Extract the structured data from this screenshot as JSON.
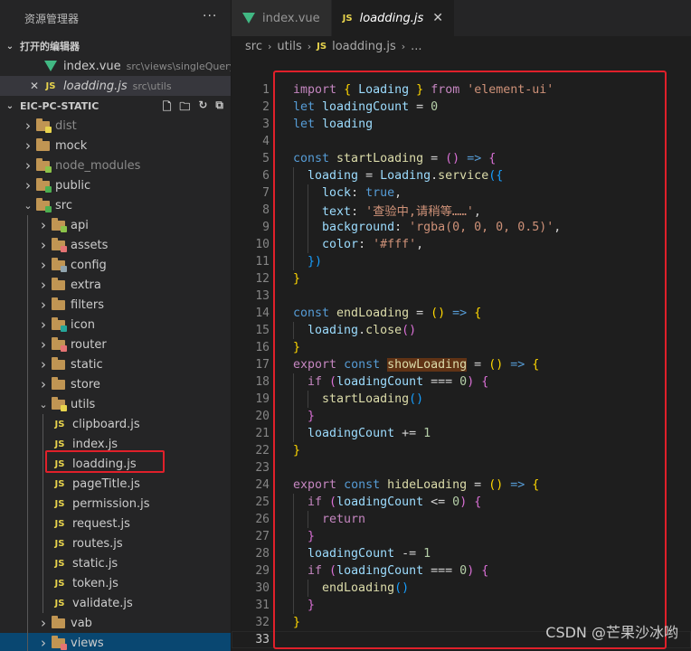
{
  "sidebar": {
    "title": "资源管理器",
    "more": "···",
    "open_editors": {
      "label": "打开的编辑器",
      "items": [
        {
          "name": "index.vue",
          "path": "src\\views\\singleQuery",
          "type": "vue"
        },
        {
          "name": "loadding.js",
          "path": "src\\utils",
          "type": "js"
        }
      ]
    },
    "project": {
      "label": "EIC-PC-STATIC",
      "tree": [
        {
          "label": "dist",
          "depth": 1,
          "folder": true,
          "open": false,
          "dim": true,
          "badge": "#e8d44d"
        },
        {
          "label": "mock",
          "depth": 1,
          "folder": true,
          "open": false
        },
        {
          "label": "node_modules",
          "depth": 1,
          "folder": true,
          "open": false,
          "dim": true,
          "badge": "#8bc34a"
        },
        {
          "label": "public",
          "depth": 1,
          "folder": true,
          "open": false,
          "badge": "#4caf50"
        },
        {
          "label": "src",
          "depth": 1,
          "folder": true,
          "open": true,
          "badge": "#4caf50"
        },
        {
          "label": "api",
          "depth": 2,
          "folder": true,
          "open": false,
          "badge": "#8bc34a"
        },
        {
          "label": "assets",
          "depth": 2,
          "folder": true,
          "open": false,
          "badge": "#e57373"
        },
        {
          "label": "config",
          "depth": 2,
          "folder": true,
          "open": false,
          "badge": "#90a4ae"
        },
        {
          "label": "extra",
          "depth": 2,
          "folder": true,
          "open": false
        },
        {
          "label": "filters",
          "depth": 2,
          "folder": true,
          "open": false
        },
        {
          "label": "icon",
          "depth": 2,
          "folder": true,
          "open": false,
          "badge": "#26a69a"
        },
        {
          "label": "router",
          "depth": 2,
          "folder": true,
          "open": false,
          "badge": "#e57373"
        },
        {
          "label": "static",
          "depth": 2,
          "folder": true,
          "open": false
        },
        {
          "label": "store",
          "depth": 2,
          "folder": true,
          "open": false
        },
        {
          "label": "utils",
          "depth": 2,
          "folder": true,
          "open": true,
          "badge": "#e8d44d"
        },
        {
          "label": "clipboard.js",
          "depth": 3,
          "folder": false
        },
        {
          "label": "index.js",
          "depth": 3,
          "folder": false
        },
        {
          "label": "loadding.js",
          "depth": 3,
          "folder": false,
          "selected": true
        },
        {
          "label": "pageTitle.js",
          "depth": 3,
          "folder": false
        },
        {
          "label": "permission.js",
          "depth": 3,
          "folder": false
        },
        {
          "label": "request.js",
          "depth": 3,
          "folder": false
        },
        {
          "label": "routes.js",
          "depth": 3,
          "folder": false
        },
        {
          "label": "static.js",
          "depth": 3,
          "folder": false
        },
        {
          "label": "token.js",
          "depth": 3,
          "folder": false
        },
        {
          "label": "validate.js",
          "depth": 3,
          "folder": false
        },
        {
          "label": "vab",
          "depth": 2,
          "folder": true,
          "open": false
        },
        {
          "label": "views",
          "depth": 2,
          "folder": true,
          "open": false,
          "active": true,
          "badge": "#e57373"
        }
      ]
    },
    "icons": {
      "new_file": "new-file-icon",
      "new_folder": "new-folder-icon",
      "refresh": "refresh-icon",
      "collapse": "collapse-all-icon"
    }
  },
  "tabs": [
    {
      "label": "index.vue",
      "type": "vue",
      "active": false
    },
    {
      "label": "loadding.js",
      "type": "js",
      "active": true
    }
  ],
  "breadcrumb": [
    "src",
    "utils",
    "loadding.js",
    "..."
  ],
  "code": [
    [
      [
        "kw2",
        "import"
      ],
      [
        "op",
        " "
      ],
      [
        "b1",
        "{"
      ],
      [
        "op",
        " "
      ],
      [
        "vr",
        "Loading"
      ],
      [
        "op",
        " "
      ],
      [
        "b1",
        "}"
      ],
      [
        "op",
        " "
      ],
      [
        "kw2",
        "from"
      ],
      [
        "op",
        " "
      ],
      [
        "st",
        "'element-ui'"
      ]
    ],
    [
      [
        "kw",
        "let"
      ],
      [
        "op",
        " "
      ],
      [
        "vr",
        "loadingCount"
      ],
      [
        "op",
        " = "
      ],
      [
        "nm",
        "0"
      ]
    ],
    [
      [
        "kw",
        "let"
      ],
      [
        "op",
        " "
      ],
      [
        "vr",
        "loading"
      ]
    ],
    [],
    [
      [
        "kw",
        "const"
      ],
      [
        "op",
        " "
      ],
      [
        "fn",
        "startLoading"
      ],
      [
        "op",
        " = "
      ],
      [
        "b2",
        "()"
      ],
      [
        "op",
        " "
      ],
      [
        "kw",
        "=>"
      ],
      [
        "op",
        " "
      ],
      [
        "b2",
        "{"
      ]
    ],
    [
      [
        "op",
        "  "
      ],
      [
        "vr",
        "loading"
      ],
      [
        "op",
        " = "
      ],
      [
        "vr",
        "Loading"
      ],
      [
        "op",
        "."
      ],
      [
        "fn",
        "service"
      ],
      [
        "b3",
        "({"
      ]
    ],
    [
      [
        "op",
        "    "
      ],
      [
        "vr",
        "lock"
      ],
      [
        "op",
        ": "
      ],
      [
        "kw",
        "true"
      ],
      [
        "op",
        ","
      ]
    ],
    [
      [
        "op",
        "    "
      ],
      [
        "vr",
        "text"
      ],
      [
        "op",
        ": "
      ],
      [
        "st",
        "'查验中,请稍等……'"
      ],
      [
        "op",
        ","
      ]
    ],
    [
      [
        "op",
        "    "
      ],
      [
        "vr",
        "background"
      ],
      [
        "op",
        ": "
      ],
      [
        "st",
        "'rgba(0, 0, 0, 0.5)'"
      ],
      [
        "op",
        ","
      ]
    ],
    [
      [
        "op",
        "    "
      ],
      [
        "vr",
        "color"
      ],
      [
        "op",
        ": "
      ],
      [
        "st",
        "'#fff'"
      ],
      [
        "op",
        ","
      ]
    ],
    [
      [
        "op",
        "  "
      ],
      [
        "b3",
        "})"
      ]
    ],
    [
      [
        "b1",
        "}"
      ]
    ],
    [],
    [
      [
        "kw",
        "const"
      ],
      [
        "op",
        " "
      ],
      [
        "fn",
        "endLoading"
      ],
      [
        "op",
        " = "
      ],
      [
        "b1",
        "()"
      ],
      [
        "op",
        " "
      ],
      [
        "kw",
        "=>"
      ],
      [
        "op",
        " "
      ],
      [
        "b1",
        "{"
      ]
    ],
    [
      [
        "op",
        "  "
      ],
      [
        "vr",
        "loading"
      ],
      [
        "op",
        "."
      ],
      [
        "fn",
        "close"
      ],
      [
        "b2",
        "()"
      ]
    ],
    [
      [
        "b1",
        "}"
      ]
    ],
    [
      [
        "kw2",
        "export"
      ],
      [
        "op",
        " "
      ],
      [
        "kw",
        "const"
      ],
      [
        "op",
        " "
      ],
      [
        "fn wordhl",
        "showLoading"
      ],
      [
        "op",
        " = "
      ],
      [
        "b1",
        "()"
      ],
      [
        "op",
        " "
      ],
      [
        "kw",
        "=>"
      ],
      [
        "op",
        " "
      ],
      [
        "b1",
        "{"
      ]
    ],
    [
      [
        "op",
        "  "
      ],
      [
        "kw2",
        "if"
      ],
      [
        "op",
        " "
      ],
      [
        "b2",
        "("
      ],
      [
        "vr",
        "loadingCount"
      ],
      [
        "op",
        " === "
      ],
      [
        "nm",
        "0"
      ],
      [
        "b2",
        ")"
      ],
      [
        "op",
        " "
      ],
      [
        "b2",
        "{"
      ]
    ],
    [
      [
        "op",
        "    "
      ],
      [
        "fn",
        "startLoading"
      ],
      [
        "b3",
        "()"
      ]
    ],
    [
      [
        "op",
        "  "
      ],
      [
        "b2",
        "}"
      ]
    ],
    [
      [
        "op",
        "  "
      ],
      [
        "vr",
        "loadingCount"
      ],
      [
        "op",
        " += "
      ],
      [
        "nm",
        "1"
      ]
    ],
    [
      [
        "b1",
        "}"
      ]
    ],
    [],
    [
      [
        "kw2",
        "export"
      ],
      [
        "op",
        " "
      ],
      [
        "kw",
        "const"
      ],
      [
        "op",
        " "
      ],
      [
        "fn",
        "hideLoading"
      ],
      [
        "op",
        " = "
      ],
      [
        "b1",
        "()"
      ],
      [
        "op",
        " "
      ],
      [
        "kw",
        "=>"
      ],
      [
        "op",
        " "
      ],
      [
        "b1",
        "{"
      ]
    ],
    [
      [
        "op",
        "  "
      ],
      [
        "kw2",
        "if"
      ],
      [
        "op",
        " "
      ],
      [
        "b2",
        "("
      ],
      [
        "vr",
        "loadingCount"
      ],
      [
        "op",
        " <= "
      ],
      [
        "nm",
        "0"
      ],
      [
        "b2",
        ")"
      ],
      [
        "op",
        " "
      ],
      [
        "b2",
        "{"
      ]
    ],
    [
      [
        "op",
        "    "
      ],
      [
        "kw2",
        "return"
      ]
    ],
    [
      [
        "op",
        "  "
      ],
      [
        "b2",
        "}"
      ]
    ],
    [
      [
        "op",
        "  "
      ],
      [
        "vr",
        "loadingCount"
      ],
      [
        "op",
        " -= "
      ],
      [
        "nm",
        "1"
      ]
    ],
    [
      [
        "op",
        "  "
      ],
      [
        "kw2",
        "if"
      ],
      [
        "op",
        " "
      ],
      [
        "b2",
        "("
      ],
      [
        "vr",
        "loadingCount"
      ],
      [
        "op",
        " === "
      ],
      [
        "nm",
        "0"
      ],
      [
        "b2",
        ")"
      ],
      [
        "op",
        " "
      ],
      [
        "b2",
        "{"
      ]
    ],
    [
      [
        "op",
        "    "
      ],
      [
        "fn",
        "endLoading"
      ],
      [
        "b3",
        "()"
      ]
    ],
    [
      [
        "op",
        "  "
      ],
      [
        "b2",
        "}"
      ]
    ],
    [
      [
        "b1",
        "}"
      ]
    ],
    []
  ],
  "watermark": "CSDN @芒果沙冰哟",
  "colors": {
    "highlight_border": "#e0202a",
    "js_icon": "#e8d44d",
    "vue_icon": "#41b883",
    "folder": "#c09553"
  }
}
